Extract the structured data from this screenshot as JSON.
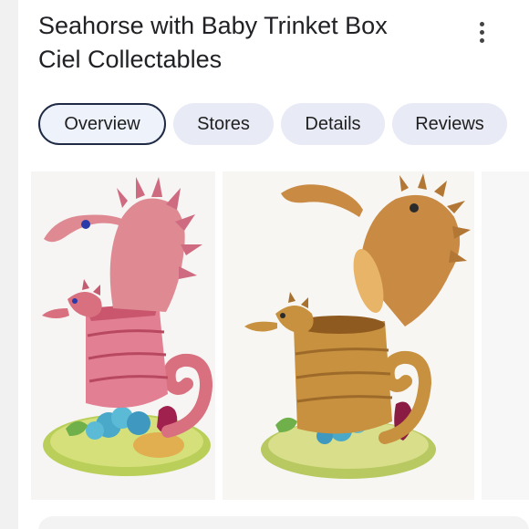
{
  "product": {
    "title_line1": "Seahorse with Baby Trinket Box",
    "title_line2": "Ciel Collectables"
  },
  "menu": {
    "icon": "more-vert-icon"
  },
  "tabs": [
    {
      "label": "Overview",
      "active": true
    },
    {
      "label": "Stores",
      "active": false
    },
    {
      "label": "Details",
      "active": false
    },
    {
      "label": "Reviews",
      "active": false
    }
  ],
  "colors": {
    "tab_background": "#e8eaf6",
    "tab_active_border": "#1f2a44",
    "pink_enamel": "#e07a8e",
    "gold": "#c8913f",
    "coral_blue": "#4aa8c9",
    "base_green": "#b7cf57"
  }
}
